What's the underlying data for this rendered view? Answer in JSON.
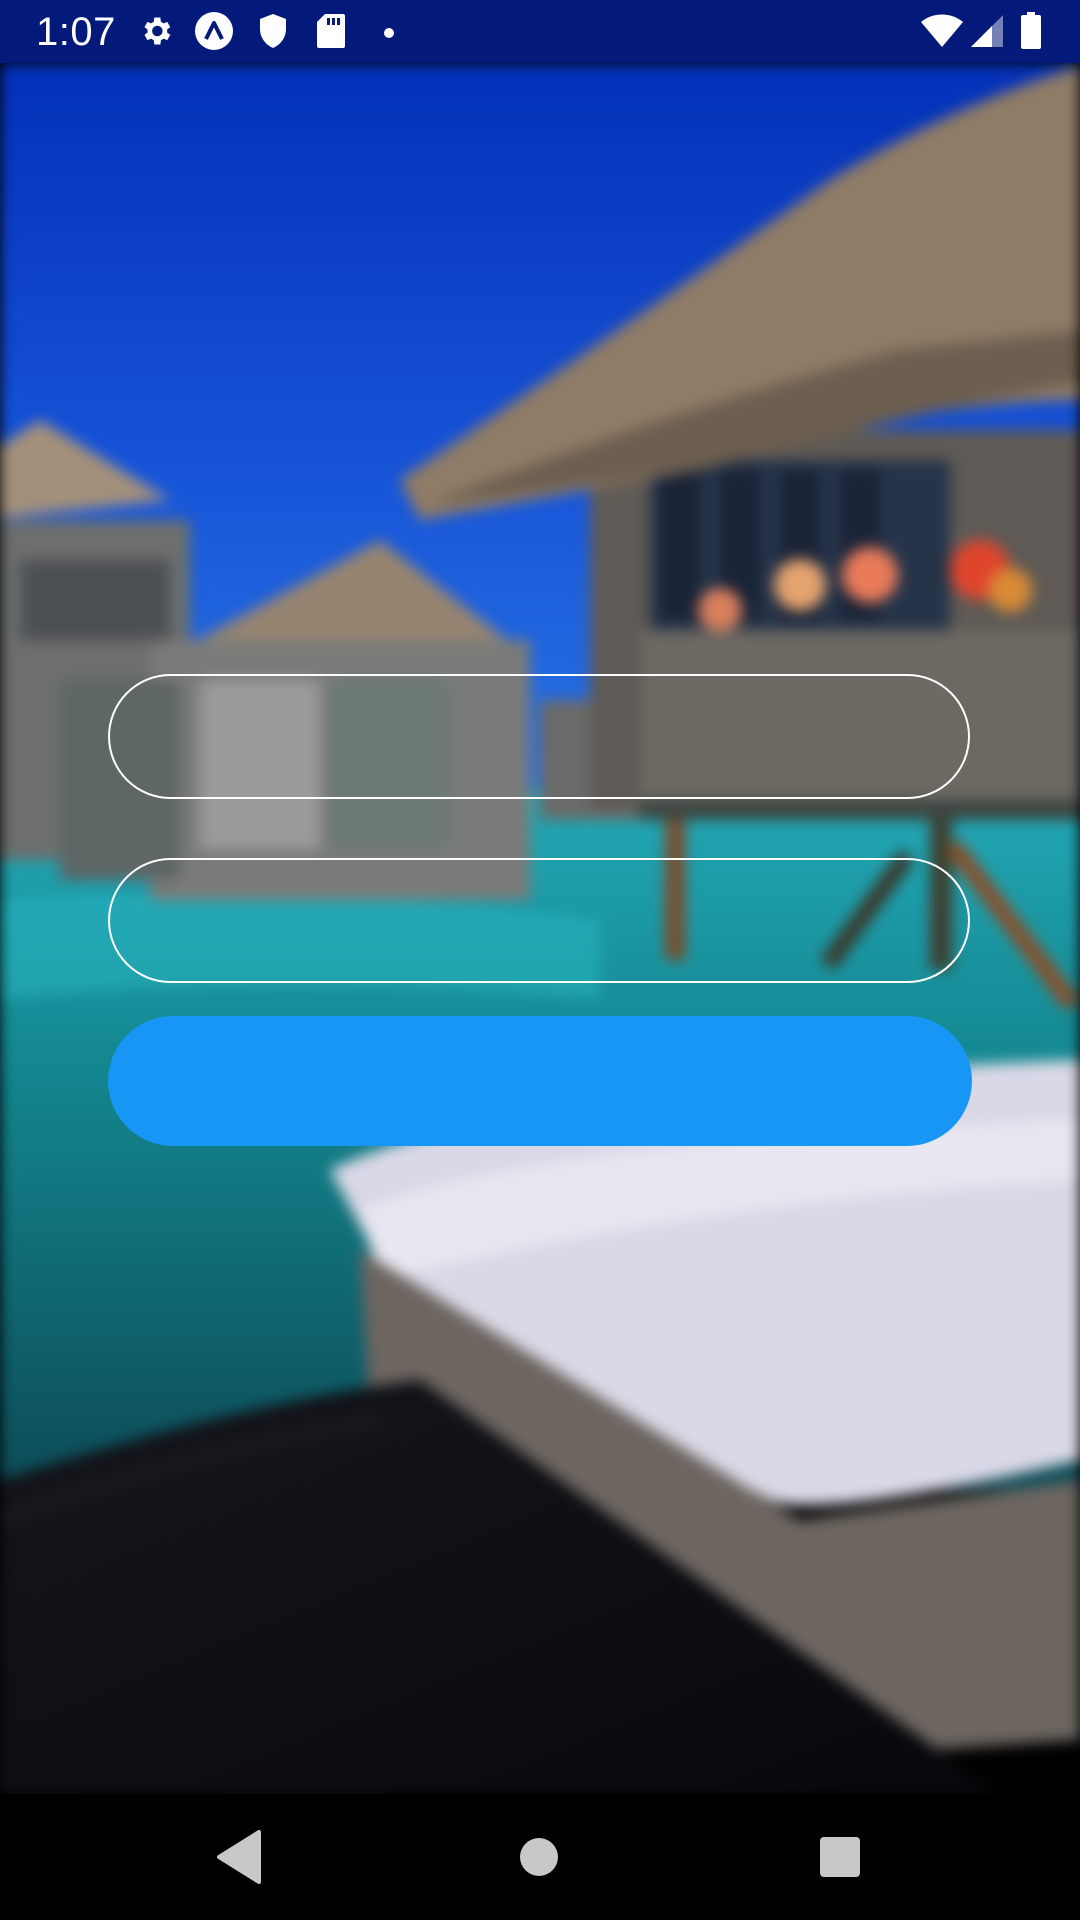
{
  "status_bar": {
    "time": "1:07",
    "icons_left": [
      "gear-icon",
      "app-logo-icon",
      "shield-icon",
      "sd-card-icon",
      "dot-icon"
    ],
    "icons_right": [
      "wifi-icon",
      "signal-icon",
      "battery-icon"
    ]
  },
  "form": {
    "username": {
      "value": "",
      "placeholder": ""
    },
    "password": {
      "value": "",
      "placeholder": ""
    },
    "submit_label": ""
  },
  "colors": {
    "status_bar_bg": "#031a7a",
    "accent_button": "#1896f5",
    "field_border": "#ffffff",
    "nav_bar_bg": "#000000"
  },
  "nav_bar": {
    "buttons": [
      "back-icon",
      "home-icon",
      "recents-icon"
    ]
  }
}
